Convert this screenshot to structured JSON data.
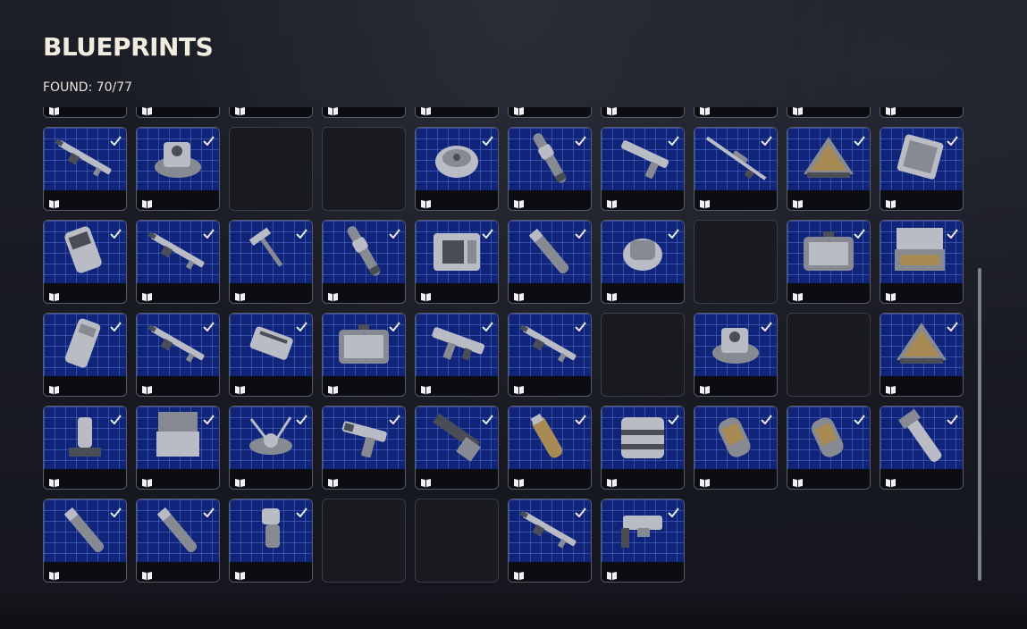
{
  "title": "BLUEPRINTS",
  "found_label": "FOUND: 70/77",
  "colors": {
    "card_art_bg": "#10247a",
    "grid_line": "#7896ff",
    "check": "#e8e8e8",
    "title": "#f2ece0"
  },
  "icons": {
    "found": "check-icon",
    "blueprint": "book-icon"
  },
  "grid": {
    "columns": 10,
    "rows": [
      [
        "found",
        "found",
        "found",
        "found",
        "found",
        "found",
        "found",
        "found",
        "found",
        "found"
      ],
      [
        "rifle",
        "turret",
        "empty",
        "empty",
        "mine",
        "launcher",
        "pistol-long",
        "sniper",
        "triangle-box",
        "panel"
      ],
      [
        "gauntlet",
        "rifle",
        "hammer",
        "launcher",
        "crate",
        "tube",
        "device",
        "empty",
        "case",
        "case-open"
      ],
      [
        "armplate",
        "rifle",
        "magazine",
        "case",
        "smg",
        "rifle",
        "empty",
        "turret",
        "empty",
        "triangle-box"
      ],
      [
        "pedestal",
        "kit",
        "drone",
        "pistol",
        "stock",
        "grenade",
        "barrel",
        "canister",
        "canister",
        "mortar"
      ],
      [
        "tube",
        "tube",
        "nozzle",
        "empty",
        "empty",
        "rifle",
        "smg-box"
      ]
    ]
  }
}
